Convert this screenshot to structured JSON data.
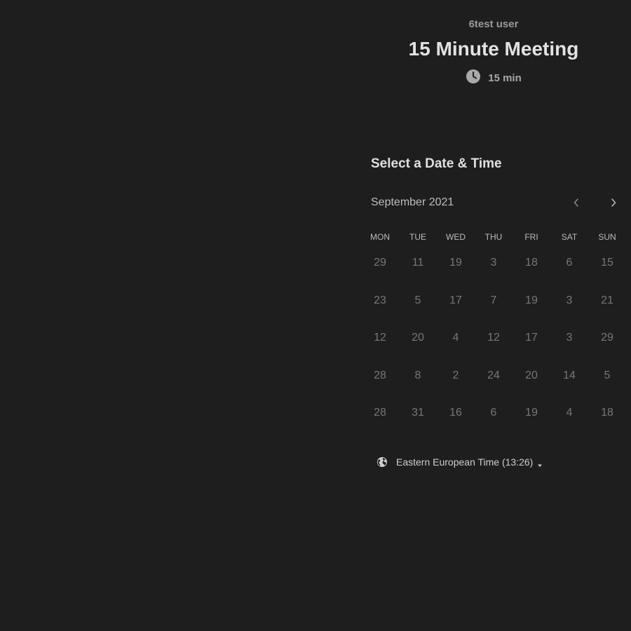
{
  "header": {
    "host_name": "6test user",
    "event_title": "15 Minute Meeting",
    "duration": "15 min",
    "duration_icon": "clock-icon"
  },
  "scheduler": {
    "heading": "Select a Date & Time",
    "month_label": "September 2021",
    "prev_icon": "chevron-left-icon",
    "next_icon": "chevron-right-icon",
    "weekdays": [
      "MON",
      "TUE",
      "WED",
      "THU",
      "FRI",
      "SAT",
      "SUN"
    ],
    "weeks": [
      [
        "29",
        "11",
        "19",
        "3",
        "18",
        "6",
        "15"
      ],
      [
        "23",
        "5",
        "17",
        "7",
        "19",
        "3",
        "21"
      ],
      [
        "12",
        "20",
        "4",
        "12",
        "17",
        "3",
        "29"
      ],
      [
        "28",
        "8",
        "2",
        "24",
        "20",
        "14",
        "5"
      ],
      [
        "28",
        "31",
        "16",
        "6",
        "19",
        "4",
        "18"
      ]
    ]
  },
  "timezone": {
    "label": "Eastern European Time (13:26)",
    "icon": "globe-icon",
    "dropdown_icon": "caret-down-icon"
  },
  "colors": {
    "background": "#1e1e1e",
    "title_text": "#e2e2e2",
    "muted_text": "#9a9a9a",
    "day_text": "#777777"
  }
}
